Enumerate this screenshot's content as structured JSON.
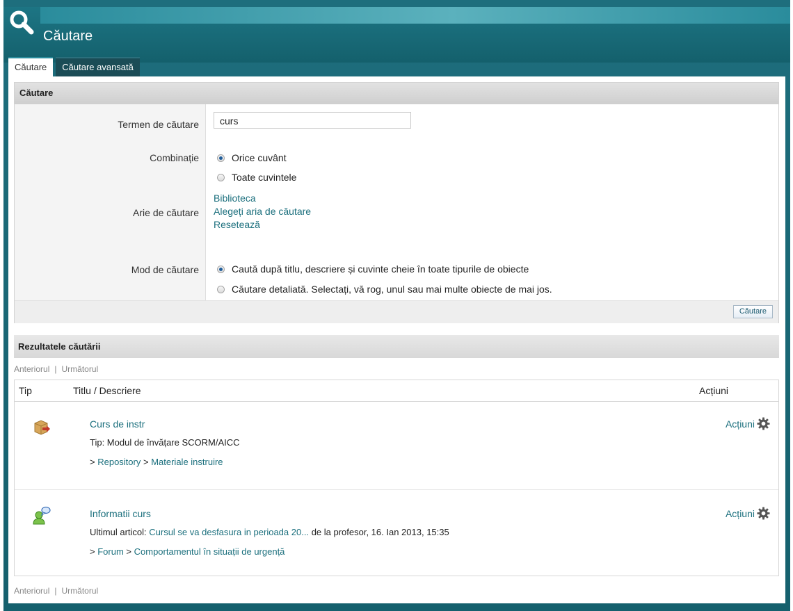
{
  "header": {
    "title": "Căutare"
  },
  "tabs": [
    {
      "label": "Căutare",
      "active": true
    },
    {
      "label": "Căutare avansată",
      "active": false
    }
  ],
  "search_panel": {
    "title": "Căutare",
    "term_label": "Termen de căutare",
    "term_value": "curs",
    "combination_label": "Combinație",
    "combination_options": [
      {
        "label": "Orice cuvânt",
        "selected": true
      },
      {
        "label": "Toate cuvintele",
        "selected": false
      }
    ],
    "area_label": "Arie de căutare",
    "area_links": [
      "Biblioteca",
      "Alegeți aria de căutare",
      "Resetează"
    ],
    "mode_label": "Mod de căutare",
    "mode_options": [
      {
        "label": "Caută după titlu, descriere și cuvinte cheie în toate tipurile de obiecte",
        "selected": true
      },
      {
        "label": "Căutare detaliată. Selectați, vă rog, unul sau mai multe obiecte de mai jos.",
        "selected": false
      }
    ],
    "submit_label": "Căutare"
  },
  "results": {
    "title": "Rezultatele căutării",
    "pager": {
      "prev": "Anteriorul",
      "separator": "|",
      "next": "Următorul"
    },
    "columns": [
      "Tip",
      "Titlu / Descriere",
      "Acțiuni"
    ],
    "items": [
      {
        "icon": "scorm-module-icon",
        "title": "Curs de instr",
        "meta_prefix": "Tip: Modul de învățare SCORM/AICC",
        "path_prefix": ">",
        "path": [
          "Repository",
          "Materiale instruire"
        ],
        "action_label": "Acțiuni"
      },
      {
        "icon": "forum-icon",
        "title": "Informatii curs",
        "meta_prefix": "Ultimul articol:",
        "meta_link": "Cursul se va desfasura in perioada 20...",
        "meta_suffix": "de la profesor, 16. Ian 2013, 15:35",
        "path_prefix": ">",
        "path": [
          "Forum",
          "Comportamentul în situații de urgență"
        ],
        "action_label": "Acțiuni"
      }
    ]
  },
  "colors": {
    "frame": "#1e6e7d",
    "link": "#1b6f7d",
    "panel_head": "#d8d8d8"
  }
}
